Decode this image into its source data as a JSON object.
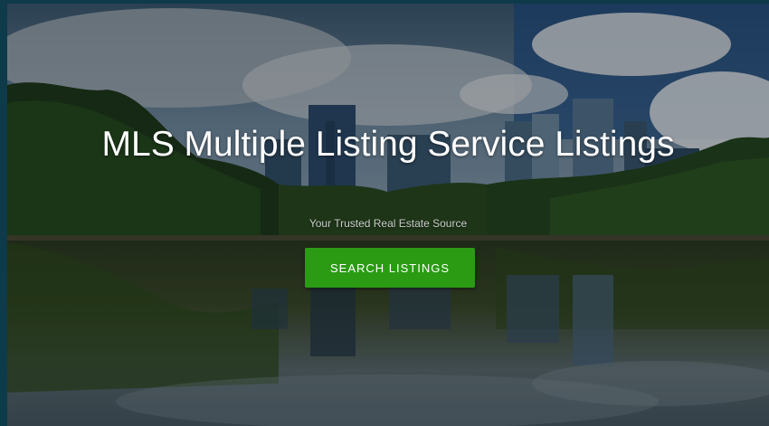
{
  "hero": {
    "title": "MLS Multiple Listing Service Listings",
    "subtitle": "Your Trusted Real Estate Source",
    "button_label": "SEARCH LISTINGS",
    "button_color": "#2a9b13",
    "background_image": "city-skyline-lake-photo"
  }
}
